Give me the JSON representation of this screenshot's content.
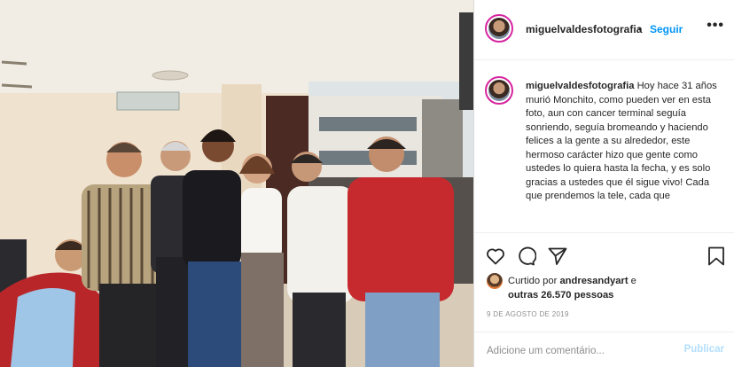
{
  "post": {
    "username": "miguelvaldesfotografia",
    "separator": "•",
    "follow_label": "Seguir",
    "more_label": "•••",
    "caption_text": "Hoy hace 31 años murió Monchito, como pueden ver en esta foto, aun con cancer terminal seguía sonriendo, seguía bromeando y haciendo felices a la gente a su alrededor, este hermoso carácter hizo que gente como ustedes lo quiera hasta la fecha, y es solo gracias a ustedes que él sigue vivo! Cada que prendemos la tele, cada que",
    "actions": {
      "like_icon": "heart-icon",
      "comment_icon": "comment-icon",
      "share_icon": "share-icon",
      "save_icon": "bookmark-icon"
    },
    "likes": {
      "prefix": "Curtido por ",
      "user": "andresandyart",
      "middle": " e",
      "others": "outras 26.570 pessoas"
    },
    "date": "9 DE AGOSTO DE 2019",
    "comment_placeholder": "Adicione um comentário...",
    "publish_label": "Publicar",
    "colors": {
      "link": "#0095f6",
      "publish_disabled": "#b2dffc",
      "avatar_ring": "#d6249f"
    }
  }
}
